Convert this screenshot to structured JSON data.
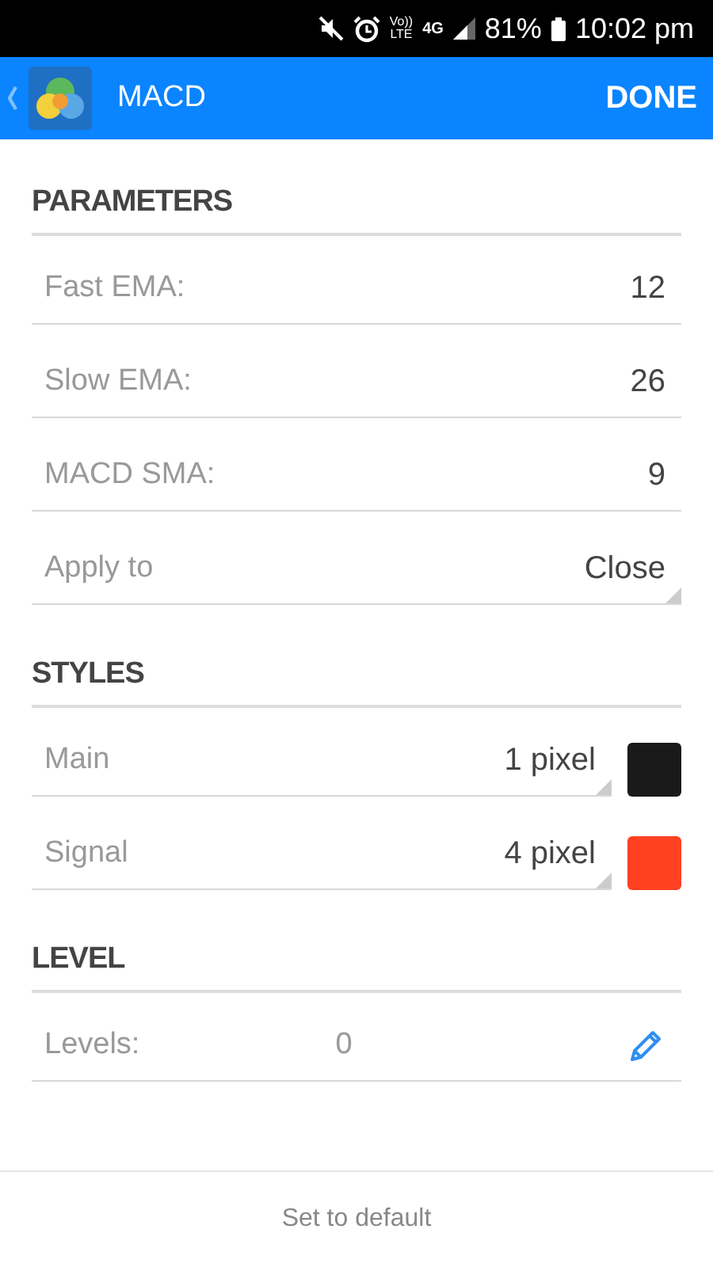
{
  "status_bar": {
    "volte": [
      "Vo))",
      "LTE"
    ],
    "network": "4G",
    "battery": "81%",
    "time": "10:02 pm"
  },
  "app_bar": {
    "title": "MACD",
    "action": "DONE"
  },
  "sections": [
    {
      "title": "PARAMETERS",
      "rows": [
        {
          "kind": "number",
          "label": "Fast EMA:",
          "value": "12"
        },
        {
          "kind": "number",
          "label": "Slow EMA:",
          "value": "26"
        },
        {
          "kind": "number",
          "label": "MACD SMA:",
          "value": "9"
        },
        {
          "kind": "dropdown",
          "label": "Apply to",
          "value": "Close"
        }
      ]
    },
    {
      "title": "STYLES",
      "rows": [
        {
          "kind": "style",
          "label": "Main",
          "value": "1 pixel",
          "color": "#1a1a1a"
        },
        {
          "kind": "style",
          "label": "Signal",
          "value": "4 pixel",
          "color": "#ff4122"
        }
      ]
    },
    {
      "title": "LEVEL",
      "rows": [
        {
          "kind": "levels",
          "label": "Levels:",
          "value": "0"
        }
      ]
    }
  ],
  "footer": {
    "button": "Set to default"
  }
}
